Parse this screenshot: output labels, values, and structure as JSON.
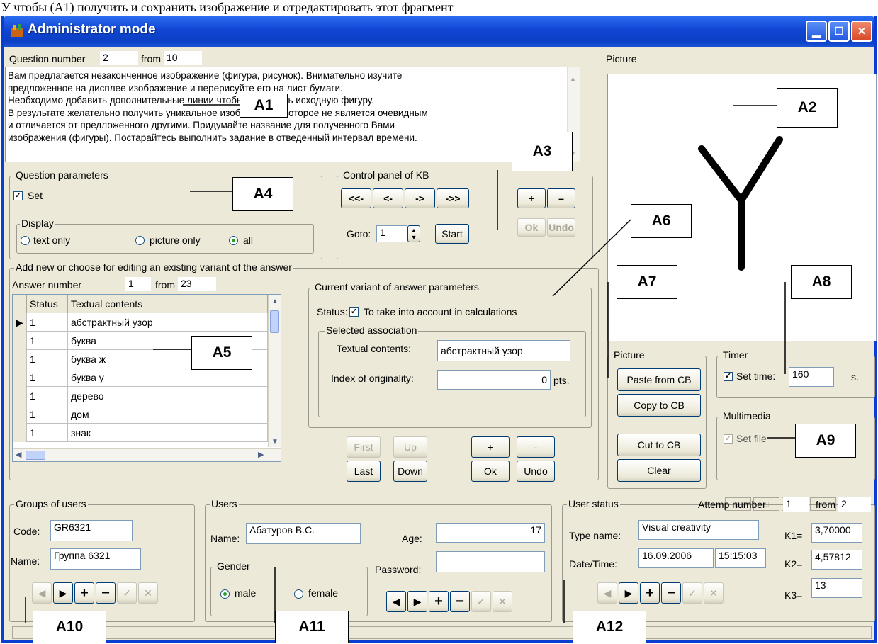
{
  "caption": "У чтобы (А1) получить и сохранить изображение и отредактировать этот фрагмент",
  "window": {
    "title": "Administrator mode"
  },
  "question": {
    "label": "Question number",
    "number": "2",
    "from_label": "from",
    "total": "10",
    "lines": [
      "Вам предлагается незаконченное изображение (фигура, рисунок). Внимательно изучите",
      "предложенное на дисплее изображение и перерисуйте его на лист бумаги.",
      "Необходимо добавить дополнительные линии чтобы дополнить исходную фигуру.",
      "В результате желательно получить уникальное изображение, которое не является очевидным",
      "и отличается от предложенного другими. Придумайте название для полученного Вами",
      "изображения (фигуры). Постарайтесь выполнить задание в отведенный интервал времени."
    ]
  },
  "picture_panel": {
    "label": "Picture"
  },
  "question_params": {
    "title": "Question parameters",
    "set_label": "Set",
    "set_checked": true,
    "display": {
      "title": "Display",
      "options": [
        "text only",
        "picture only",
        "all"
      ],
      "selected": "all"
    }
  },
  "control_panel": {
    "title": "Control panel of KB",
    "nav": [
      "<<-",
      "<-",
      "->",
      "->>"
    ],
    "plus": "+",
    "minus": "–",
    "ok": "Ok",
    "undo": "Undo",
    "goto_label": "Goto:",
    "goto_value": "1",
    "start": "Start"
  },
  "answers": {
    "title": "Add new or choose for editing an existing variant of the answer",
    "number_label": "Answer number",
    "number": "1",
    "from_label": "from",
    "total": "23",
    "columns": [
      "Status",
      "Textual contents"
    ],
    "rows": [
      {
        "status": "1",
        "text": "абстрактный узор"
      },
      {
        "status": "1",
        "text": "буква"
      },
      {
        "status": "1",
        "text": "буква ж"
      },
      {
        "status": "1",
        "text": "буква у"
      },
      {
        "status": "1",
        "text": "дерево"
      },
      {
        "status": "1",
        "text": "дом"
      },
      {
        "status": "1",
        "text": "знак"
      }
    ]
  },
  "variant": {
    "title": "Current variant of answer parameters",
    "status_label": "Status:",
    "status_text": "To take into account in calculations",
    "assoc_title": "Selected association",
    "text_label": "Textual contents:",
    "text_value": "абстрактный узор",
    "index_label": "Index of originality:",
    "index_value": "0",
    "pts": "pts.",
    "buttons": {
      "first": "First",
      "up": "Up",
      "plus": "+",
      "minus": "-",
      "last": "Last",
      "down": "Down",
      "ok": "Ok",
      "undo": "Undo"
    }
  },
  "picture_group": {
    "title": "Picture",
    "paste": "Paste from CB",
    "copy": "Copy to CB",
    "cut": "Cut to CB",
    "clear": "Clear"
  },
  "timer": {
    "title": "Timer",
    "set_label": "Set time:",
    "value": "160",
    "unit": "s."
  },
  "multimedia": {
    "title": "Multimedia",
    "set_label": "Set file"
  },
  "groups": {
    "title": "Groups of users",
    "code_label": "Code:",
    "code": "GR6321",
    "name_label": "Name:",
    "name": "Группа 6321"
  },
  "users": {
    "title": "Users",
    "name_label": "Name:",
    "name": "Абатуров В.С.",
    "age_label": "Age:",
    "age": "17",
    "password_label": "Password:",
    "gender_title": "Gender",
    "male": "male",
    "female": "female",
    "gender_selected": "male"
  },
  "user_status": {
    "title": "User status",
    "attempt_label": "Attemp number",
    "attempt": "1",
    "from_label": "from",
    "attempt_total": "2",
    "type_label": "Type name:",
    "type_value": "Visual creativity",
    "datetime_label": "Date/Time:",
    "date": "16.09.2006",
    "time": "15:15:03",
    "k1_label": "K1=",
    "k1": "3,70000",
    "k2_label": "K2=",
    "k2": "4,57812",
    "k3_label": "K3=",
    "k3": "13"
  },
  "annotations": {
    "a1": "A1",
    "a2": "A2",
    "a3": "A3",
    "a4": "A4",
    "a5": "A5",
    "a6": "A6",
    "a7": "A7",
    "a8": "A8",
    "a9": "A9",
    "a10": "A10",
    "a11": "A11",
    "a12": "A12"
  }
}
